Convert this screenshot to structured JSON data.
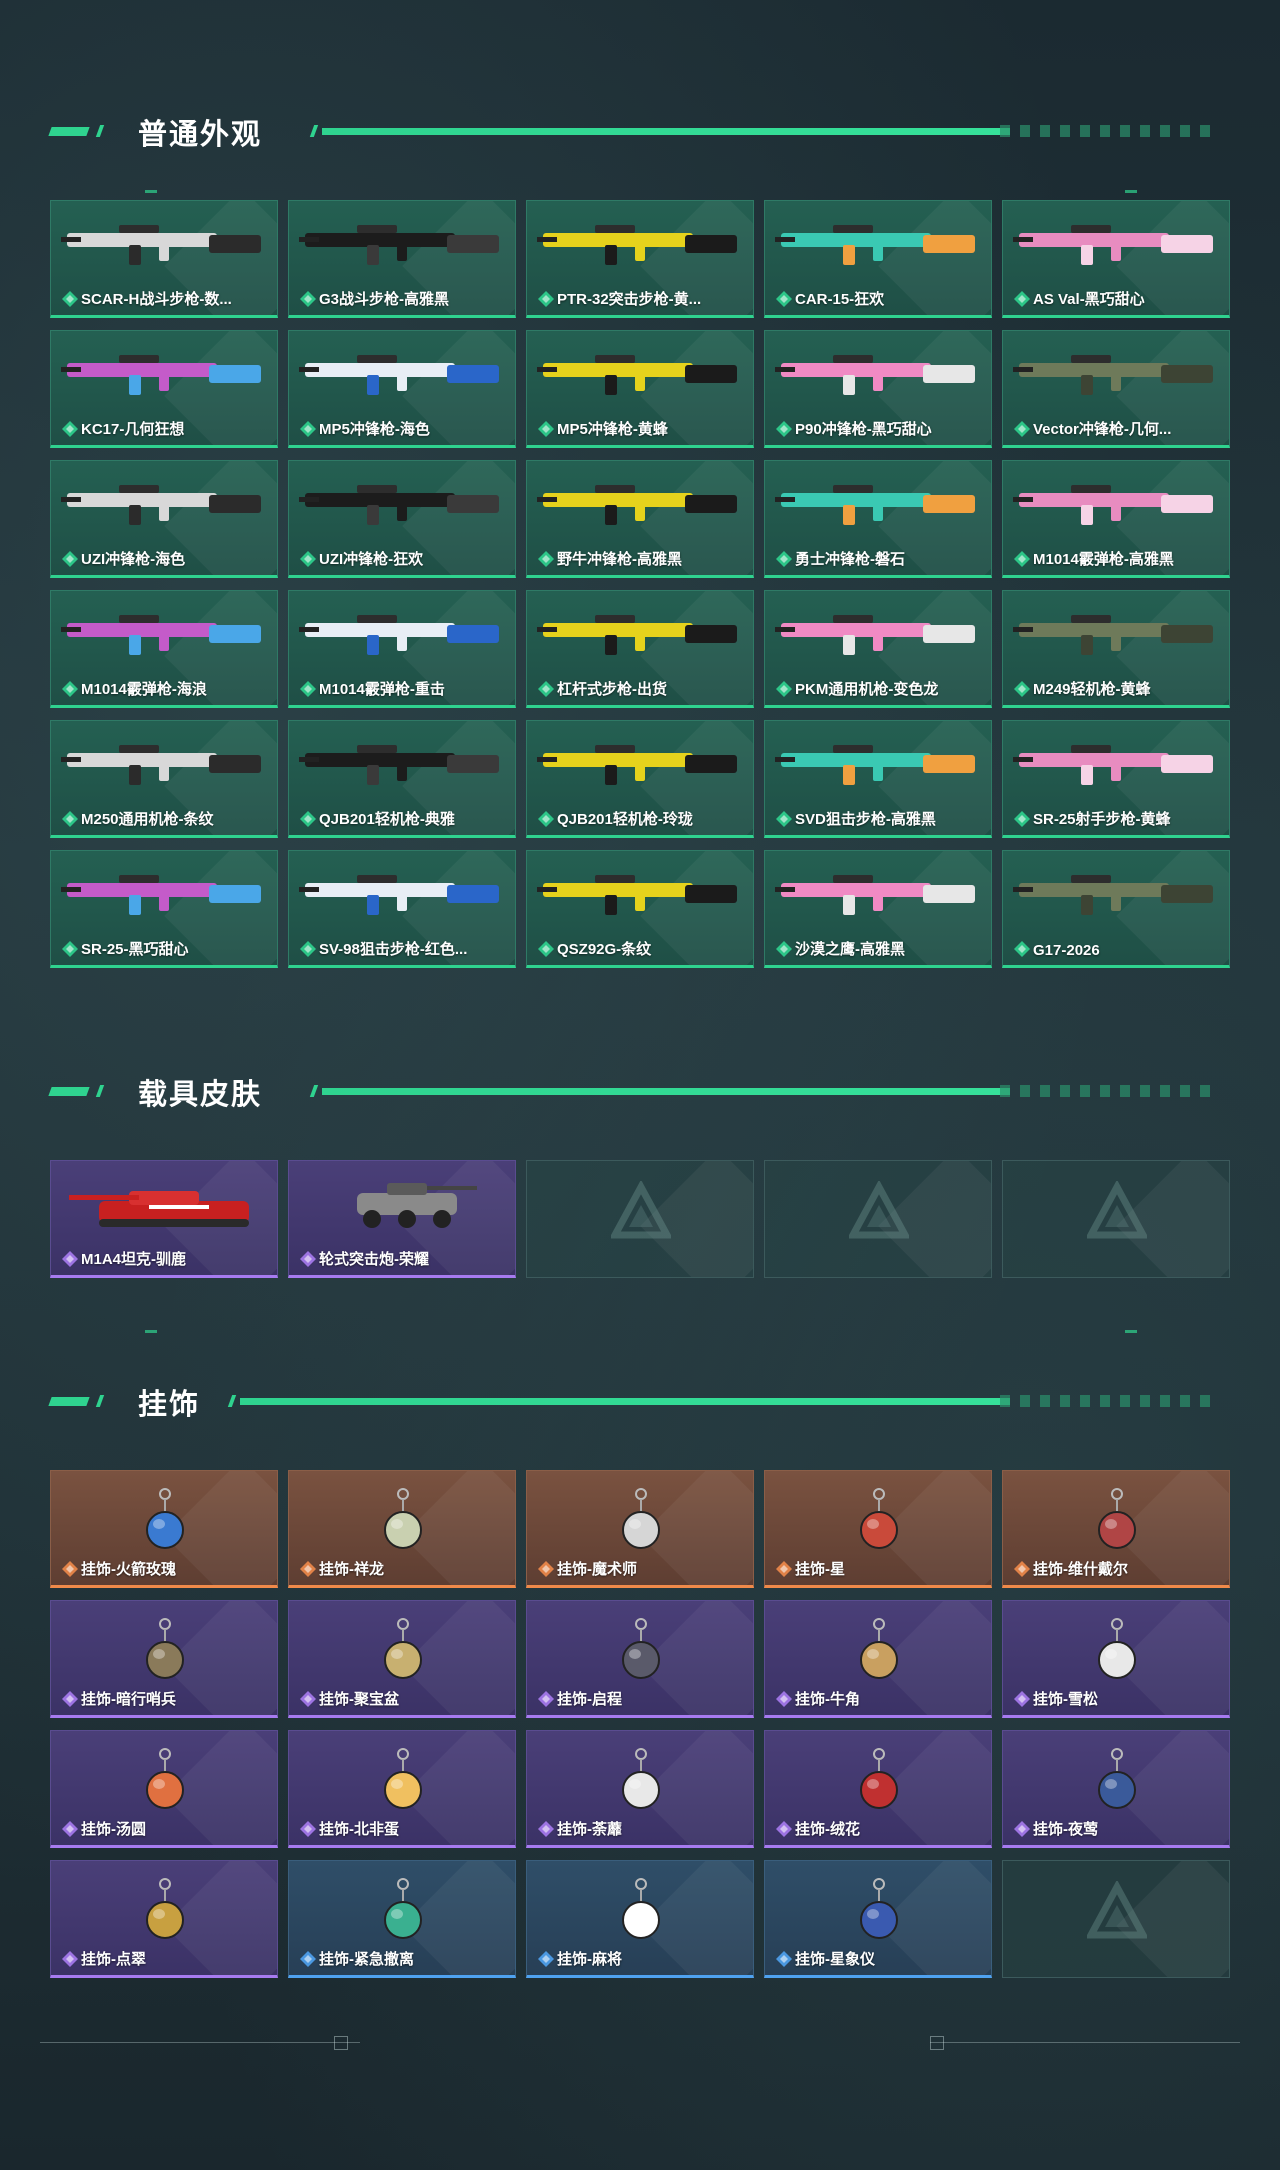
{
  "sections": {
    "weapons": {
      "title": "普通外观",
      "items": [
        "SCAR-H战斗步枪-数...",
        "G3战斗步枪-高雅黑",
        "PTR-32突击步枪-黄...",
        "CAR-15-狂欢",
        "AS Val-黑巧甜心",
        "KC17-几何狂想",
        "MP5冲锋枪-海色",
        "MP5冲锋枪-黄蜂",
        "P90冲锋枪-黑巧甜心",
        "Vector冲锋枪-几何...",
        "UZI冲锋枪-海色",
        "UZI冲锋枪-狂欢",
        "野牛冲锋枪-高雅黑",
        "勇士冲锋枪-磐石",
        "M1014霰弹枪-高雅黑",
        "M1014霰弹枪-海浪",
        "M1014霰弹枪-重击",
        "杠杆式步枪-出货",
        "PKM通用机枪-变色龙",
        "M249轻机枪-黄蜂",
        "M250通用机枪-条纹",
        "QJB201轻机枪-典雅",
        "QJB201轻机枪-玲珑",
        "SVD狙击步枪-高雅黑",
        "SR-25射手步枪-黄蜂",
        "SR-25-黑巧甜心",
        "SV-98狙击步枪-红色...",
        "QSZ92G-条纹",
        "沙漠之鹰-高雅黑",
        "G17-2026"
      ]
    },
    "vehicles": {
      "title": "载具皮肤",
      "items": [
        "M1A4坦克-驯鹿",
        "轮式突击炮-荣耀"
      ]
    },
    "charms": {
      "title": "挂饰",
      "items": [
        "挂饰-火箭玫瑰",
        "挂饰-祥龙",
        "挂饰-魔术师",
        "挂饰-星",
        "挂饰-维什戴尔",
        "挂饰-暗行哨兵",
        "挂饰-聚宝盆",
        "挂饰-启程",
        "挂饰-牛角",
        "挂饰-雪松",
        "挂饰-汤圆",
        "挂饰-北非蛋",
        "挂饰-荼蘼",
        "挂饰-绒花",
        "挂饰-夜莺",
        "挂饰-点翠",
        "挂饰-紧急撤离",
        "挂饰-麻将",
        "挂饰-星象仪"
      ]
    }
  },
  "colors": {
    "accent": "#2fd38f",
    "rarity_green": "#2fd38f",
    "rarity_purple": "#a77bf0",
    "rarity_orange": "#f08a4a",
    "rarity_blue": "#4fa2f0"
  }
}
